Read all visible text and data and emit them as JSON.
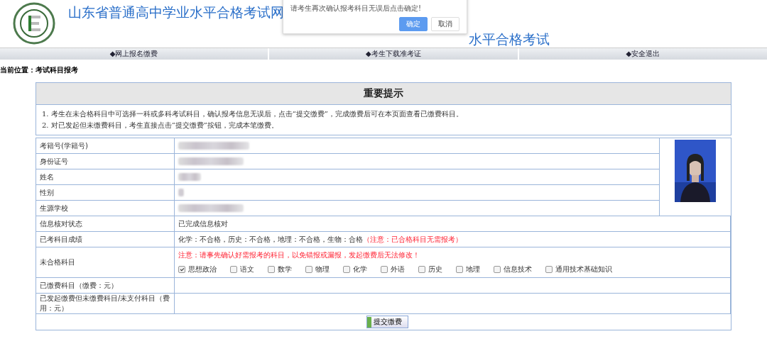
{
  "header": {
    "title": "山东省普通高中学业水平合格考试网",
    "subtitle": "水平合格考试"
  },
  "dialog": {
    "message": "请考生再次确认报考科目无误后点击确定!",
    "buttons": [
      {
        "label": "确定",
        "kind": "primary"
      },
      {
        "label": "取消",
        "kind": "secondary"
      }
    ]
  },
  "nav": [
    "◆网上报名缴费",
    "◆考生下载准考证",
    "◆安全退出"
  ],
  "breadcrumb": "当前位置：考试科目报考",
  "notice": {
    "title": "重要提示",
    "lines": [
      "1. 考生在未合格科目中可选择一科或多科考试科目，确认报考信息无误后，点击“提交缴费”，完成缴费后可在本页面查看已缴费科目。",
      "2. 对已发起但未缴费科目，考生直接点击“提交缴费”按钮，完成本笔缴费。"
    ]
  },
  "rows": [
    {
      "label": "考籍号(学籍号)",
      "kind": "redacted"
    },
    {
      "label": "身份证号",
      "kind": "redacted"
    },
    {
      "label": "姓名",
      "kind": "redacted"
    },
    {
      "label": "性别",
      "kind": "redacted"
    },
    {
      "label": "生源学校",
      "kind": "redacted"
    },
    {
      "label": "信息核对状态",
      "kind": "text",
      "value": "已完成信息核对"
    },
    {
      "label": "已考科目成绩",
      "kind": "text",
      "value": "化学：不合格，历史：不合格，地理：不合格，生物：合格",
      "note": "（注意：已合格科目无需报考）"
    },
    {
      "label": "未合格科目",
      "kind": "subjects",
      "warning": "注意：请事先确认好需报考的科目，以免错报或漏报，发起缴费后无法修改！",
      "subjects": [
        {
          "label": "思想政治",
          "checked": true
        },
        {
          "label": "语文",
          "checked": false
        },
        {
          "label": "数学",
          "checked": false
        },
        {
          "label": "物理",
          "checked": false
        },
        {
          "label": "化学",
          "checked": false
        },
        {
          "label": "外语",
          "checked": false
        },
        {
          "label": "历史",
          "checked": false
        },
        {
          "label": "地理",
          "checked": false
        },
        {
          "label": "信息技术",
          "checked": false
        },
        {
          "label": "通用技术基础知识",
          "checked": false
        }
      ]
    },
    {
      "label": "已缴费科目（缴费：元）",
      "kind": "empty"
    },
    {
      "label": "已发起缴费但未缴费科目/未支付科目（费用：元）",
      "kind": "empty"
    }
  ],
  "submit": "提交缴费"
}
